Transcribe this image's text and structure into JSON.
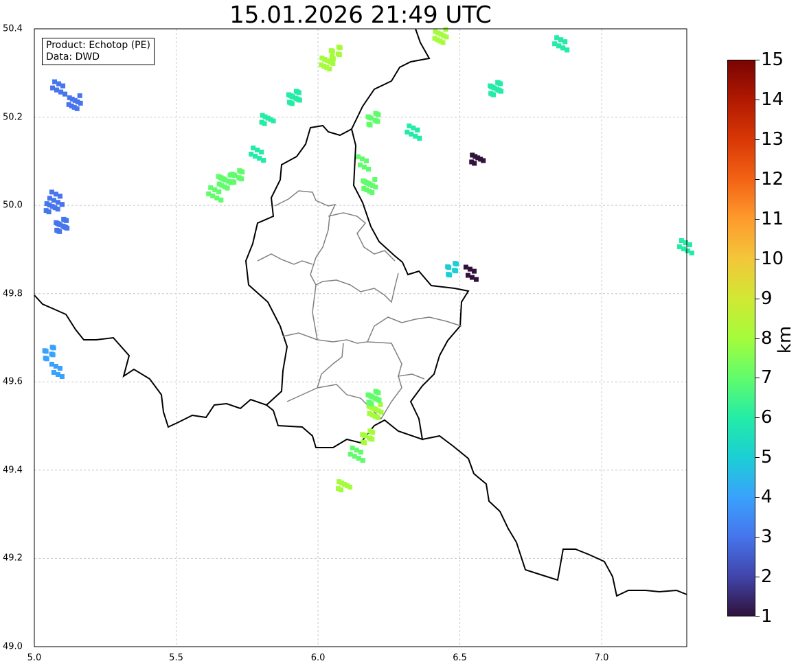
{
  "title": "15.01.2026 21:49 UTC",
  "info": {
    "product": "Product: Echotop (PE)",
    "source": "Data: DWD"
  },
  "axes": {
    "xlim": [
      5.0,
      7.3
    ],
    "ylim": [
      49.0,
      50.4
    ],
    "xticks": [
      "5.0",
      "5.5",
      "6.0",
      "6.5",
      "7.0"
    ],
    "yticks": [
      "49.0",
      "49.2",
      "49.4",
      "49.6",
      "49.8",
      "50.0",
      "50.2",
      "50.4"
    ],
    "grid": true
  },
  "colorbar": {
    "label": "km",
    "min": 1,
    "max": 15,
    "ticks": [
      "1",
      "2",
      "3",
      "4",
      "5",
      "6",
      "7",
      "8",
      "9",
      "10",
      "11",
      "12",
      "13",
      "14",
      "15"
    ],
    "colors": [
      "#30123b",
      "#4145ab",
      "#4675ed",
      "#39a2fc",
      "#1bcfd4",
      "#24eca6",
      "#61fc6c",
      "#a4fc3b",
      "#d1e834",
      "#f3c63a",
      "#fe9b2d",
      "#f36315",
      "#d93806",
      "#b11901",
      "#7a0402"
    ]
  },
  "echoes": [
    {
      "lon": 5.07,
      "lat": 50.02,
      "h": 3.0
    },
    {
      "lon": 5.05,
      "lat": 50.0,
      "h": 3.0
    },
    {
      "lon": 5.09,
      "lat": 49.96,
      "h": 3.0
    },
    {
      "lon": 5.08,
      "lat": 50.27,
      "h": 3.0
    },
    {
      "lon": 5.13,
      "lat": 50.24,
      "h": 3.0
    },
    {
      "lon": 5.05,
      "lat": 49.67,
      "h": 3.5
    },
    {
      "lon": 5.07,
      "lat": 49.63,
      "h": 3.5
    },
    {
      "lon": 5.66,
      "lat": 50.06,
      "h": 6.8
    },
    {
      "lon": 5.71,
      "lat": 50.07,
      "h": 7.0
    },
    {
      "lon": 5.63,
      "lat": 50.03,
      "h": 7.0
    },
    {
      "lon": 5.81,
      "lat": 50.2,
      "h": 6.2
    },
    {
      "lon": 5.91,
      "lat": 50.25,
      "h": 5.8
    },
    {
      "lon": 5.78,
      "lat": 50.12,
      "h": 6.0
    },
    {
      "lon": 6.02,
      "lat": 50.33,
      "h": 7.8
    },
    {
      "lon": 6.06,
      "lat": 50.35,
      "h": 7.5
    },
    {
      "lon": 6.15,
      "lat": 50.1,
      "h": 7.0
    },
    {
      "lon": 6.17,
      "lat": 50.05,
      "h": 6.5
    },
    {
      "lon": 6.19,
      "lat": 50.2,
      "h": 7.0
    },
    {
      "lon": 6.33,
      "lat": 50.17,
      "h": 6.0
    },
    {
      "lon": 6.55,
      "lat": 50.11,
      "h": 1.0
    },
    {
      "lon": 6.62,
      "lat": 50.27,
      "h": 6.0
    },
    {
      "lon": 6.85,
      "lat": 50.37,
      "h": 5.8
    },
    {
      "lon": 6.42,
      "lat": 50.39,
      "h": 7.5
    },
    {
      "lon": 6.47,
      "lat": 49.86,
      "h": 5.0
    },
    {
      "lon": 6.53,
      "lat": 49.85,
      "h": 1.0
    },
    {
      "lon": 6.19,
      "lat": 49.54,
      "h": 7.5
    },
    {
      "lon": 6.17,
      "lat": 49.48,
      "h": 7.5
    },
    {
      "lon": 6.13,
      "lat": 49.44,
      "h": 7.2
    },
    {
      "lon": 6.08,
      "lat": 49.37,
      "h": 7.5
    },
    {
      "lon": 6.19,
      "lat": 49.57,
      "h": 7.0
    },
    {
      "lon": 7.29,
      "lat": 49.91,
      "h": 6.0
    }
  ]
}
